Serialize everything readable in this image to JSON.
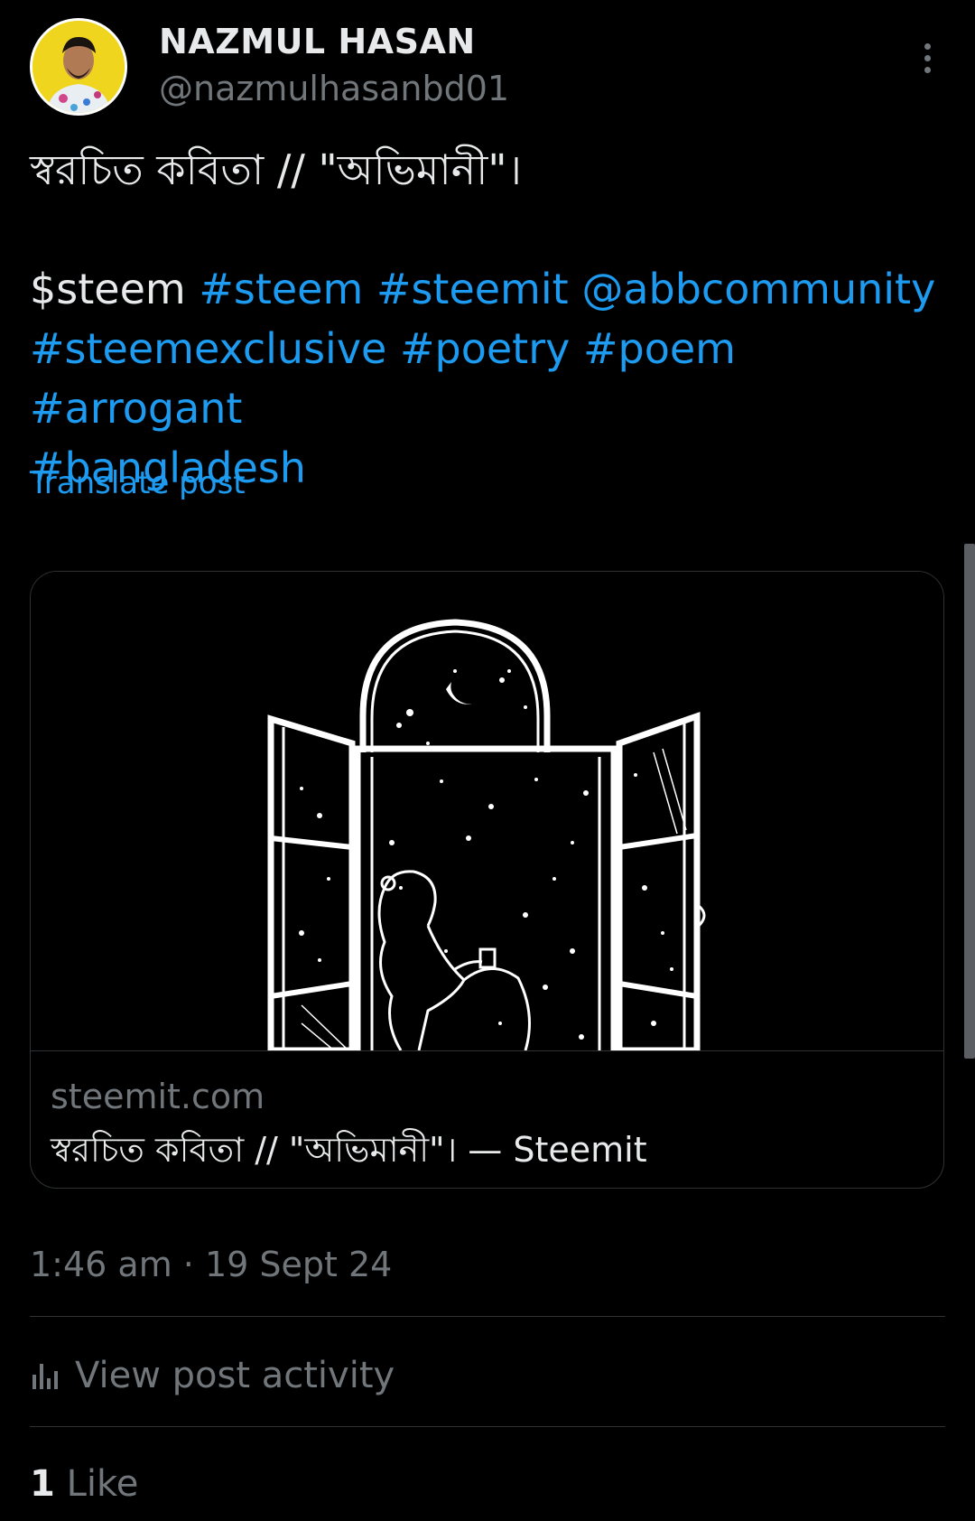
{
  "author": {
    "name": "NAZMUL HASAN",
    "handle": "@nazmulhasanbd01"
  },
  "post": {
    "title_line": "স্বরচিত কবিতা // \"অভিমানী\"।",
    "cashtag": "$steem",
    "tags_line1": [
      "#steem",
      "#steemit",
      "@abbcommunity"
    ],
    "tags_line2": [
      "#steemexclusive",
      "#poetry",
      "#poem",
      "#arrogant"
    ],
    "tags_line3": [
      "#bangladesh"
    ],
    "translate_label": "Translate post"
  },
  "link_card": {
    "domain": "steemit.com",
    "title": "স্বরচিত কবিতা // \"অভিমানী\"। — Steemit"
  },
  "meta": {
    "timestamp": "1:46 am · 19 Sept 24",
    "view_activity_label": "View post activity",
    "like_count": "1",
    "like_label": "Like"
  },
  "colors": {
    "background": "#000000",
    "text": "#e7e9ea",
    "muted": "#71767b",
    "link": "#1d9bf0",
    "divider": "#2f3336",
    "avatar_bg": "#f0d51e"
  },
  "icons": [
    "more-vertical-icon",
    "analytics-bars-icon"
  ]
}
